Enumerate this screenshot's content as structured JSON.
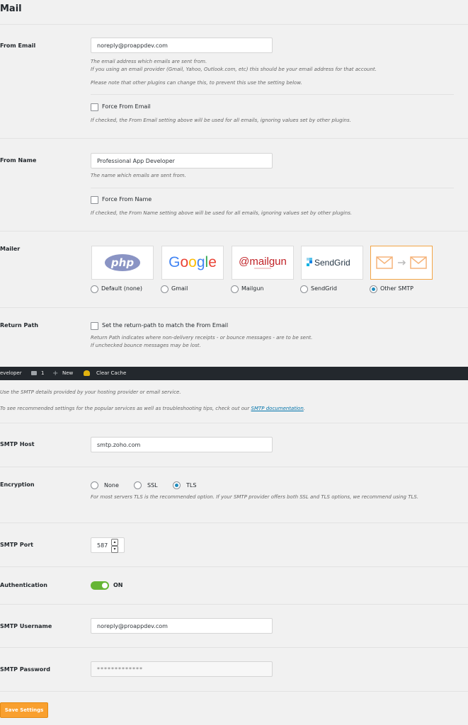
{
  "section_title": "Mail",
  "from_email": {
    "label": "From Email",
    "value": "noreply@proappdev.com",
    "desc1": "The email address which emails are sent from.",
    "desc2": "If you using an email provider (Gmail, Yahoo, Outlook.com, etc) this should be your email address for that account.",
    "desc3": "Please note that other plugins can change this, to prevent this use the setting below.",
    "force_label": "Force From Email",
    "force_desc": "If checked, the From Email setting above will be used for all emails, ignoring values set by other plugins."
  },
  "from_name": {
    "label": "From Name",
    "value": "Professional App Developer",
    "desc": "The name which emails are sent from.",
    "force_label": "Force From Name",
    "force_desc": "If checked, the From Name setting above will be used for all emails, ignoring values set by other plugins."
  },
  "mailer": {
    "label": "Mailer",
    "options": [
      {
        "logo": "php",
        "label": "Default (none)",
        "selected": false
      },
      {
        "logo": "Google",
        "label": "Gmail",
        "selected": false
      },
      {
        "logo": "@mailgun",
        "label": "Mailgun",
        "selected": false
      },
      {
        "logo": "SendGrid",
        "label": "SendGrid",
        "selected": false
      },
      {
        "logo": "envelope-arrow",
        "label": "Other SMTP",
        "selected": true
      }
    ]
  },
  "return_path": {
    "label": "Return Path",
    "checkbox_label": "Set the return-path to match the From Email",
    "desc1": "Return Path indicates where non-delivery receipts - or bounce messages - are to be sent.",
    "desc2": "If unchecked bounce messages may be lost."
  },
  "admin_bar": {
    "site": "eveloper",
    "comments_count": "1",
    "new_label": "New",
    "clear_cache": "Clear Cache"
  },
  "smtp_intro": {
    "desc1": "Use the SMTP details provided by your hosting provider or email service.",
    "desc2_prefix": "To see recommended settings for the popular services as well as troubleshooting tips, check out our ",
    "desc2_link": "SMTP documentation",
    "desc2_suffix": "."
  },
  "smtp_host": {
    "label": "SMTP Host",
    "value": "smtp.zoho.com"
  },
  "encryption": {
    "label": "Encryption",
    "options": [
      {
        "label": "None",
        "selected": false
      },
      {
        "label": "SSL",
        "selected": false
      },
      {
        "label": "TLS",
        "selected": true
      }
    ],
    "desc": "For most servers TLS is the recommended option. If your SMTP provider offers both SSL and TLS options, we recommend using TLS."
  },
  "smtp_port": {
    "label": "SMTP Port",
    "value": "587"
  },
  "authentication": {
    "label": "Authentication",
    "state": "ON"
  },
  "smtp_username": {
    "label": "SMTP Username",
    "value": "noreply@proappdev.com"
  },
  "smtp_password": {
    "label": "SMTP Password",
    "value": "*************"
  },
  "save_button": "Save Settings",
  "colors": {
    "accent": "#f9a02f",
    "toggle_on": "#65b534",
    "link": "#0073aa",
    "admin_bar": "#23282d"
  }
}
